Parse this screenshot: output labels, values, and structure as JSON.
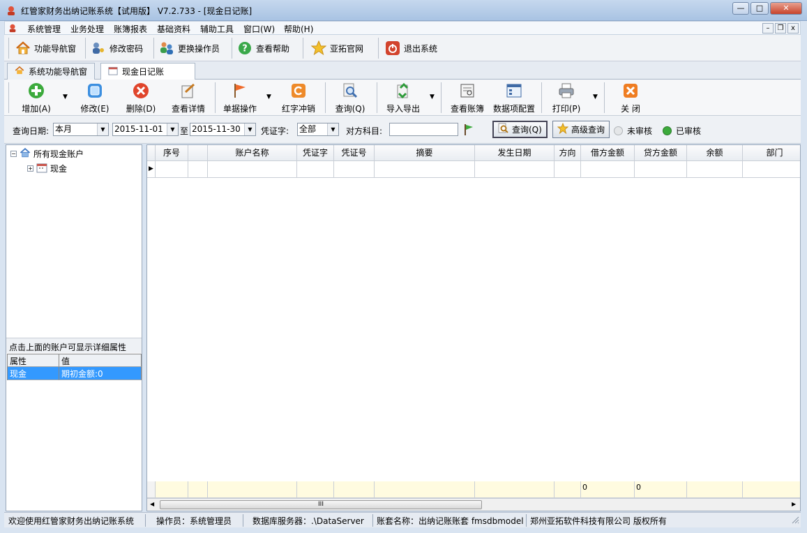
{
  "window": {
    "title": "红管家财务出纳记账系统【试用版】 V7.2.733 - [现金日记账]",
    "minimize": "—",
    "maximize": "□",
    "close": "✕"
  },
  "menu": {
    "items": [
      "系统管理",
      "业务处理",
      "账簿报表",
      "基础资料",
      "辅助工具",
      "窗口(W)",
      "帮助(H)"
    ],
    "mdi_min": "–",
    "mdi_restore": "❐",
    "mdi_close": "x"
  },
  "toolbar": {
    "items": [
      {
        "label": "功能导航窗",
        "icon": "home-icon"
      },
      {
        "label": "修改密码",
        "icon": "user-key-icon"
      },
      {
        "label": "更换操作员",
        "icon": "users-swap-icon"
      },
      {
        "label": "查看帮助",
        "icon": "help-icon"
      },
      {
        "label": "亚拓官网",
        "icon": "star-icon"
      },
      {
        "label": "退出系统",
        "icon": "power-icon"
      }
    ]
  },
  "tabs": [
    {
      "label": "系统功能导航窗",
      "icon": "home-icon"
    },
    {
      "label": "现金日记账",
      "icon": "calendar-icon"
    }
  ],
  "actions": [
    {
      "label": "增加(A)",
      "icon": "add-icon"
    },
    {
      "label": "修改(E)",
      "icon": "edit-icon"
    },
    {
      "label": "删除(D)",
      "icon": "delete-icon"
    },
    {
      "label": "查看详情",
      "icon": "detail-icon"
    },
    {
      "label": "单据操作",
      "icon": "flag-icon"
    },
    {
      "label": "红字冲销",
      "icon": "reverse-icon"
    },
    {
      "label": "查询(Q)",
      "icon": "query-icon"
    },
    {
      "label": "导入导出",
      "icon": "import-export-icon"
    },
    {
      "label": "查看账簿",
      "icon": "ledger-icon"
    },
    {
      "label": "数据项配置",
      "icon": "config-icon"
    },
    {
      "label": "打印(P)",
      "icon": "print-icon"
    },
    {
      "label": "关 闭",
      "icon": "close-icon"
    }
  ],
  "filters": {
    "date_label": "查询日期:",
    "date_range": "本月",
    "date_from": "2015-11-01",
    "to_label": "至",
    "date_to": "2015-11-30",
    "voucher_label": "凭证字:",
    "voucher_value": "全部",
    "counter_label": "对方科目:",
    "counter_value": "",
    "query_button": "查询(Q)",
    "advanced_button": "高级查询",
    "unaudited": "未审核",
    "audited": "已审核"
  },
  "tree": {
    "root": "所有现金账户",
    "child": "现金"
  },
  "properties": {
    "caption": "点击上面的账户可显示详细属性",
    "headers": [
      "属性",
      "值"
    ],
    "rows": [
      {
        "name": "现金",
        "value": "期初金额:0"
      }
    ]
  },
  "grid": {
    "columns": [
      "",
      "序号",
      "",
      "账户名称",
      "凭证字",
      "凭证号",
      "摘要",
      "发生日期",
      "方向",
      "借方金额",
      "贷方金额",
      "余额",
      "部门"
    ],
    "footer": {
      "debit": "0",
      "credit": "0"
    },
    "scroll_grip": "III"
  },
  "status": {
    "welcome": "欢迎使用红管家财务出纳记账系统",
    "operator": "操作员：系统管理员",
    "db": "数据库服务器：.\\DataServer",
    "book": "账套名称：出纳记账账套 fmsdbmodel",
    "company": "郑州亚拓软件科技有限公司 版权所有"
  },
  "colors": {
    "accent": "#3f78c3",
    "selected_row": "#3399ff",
    "footer": "#fffbe0"
  }
}
